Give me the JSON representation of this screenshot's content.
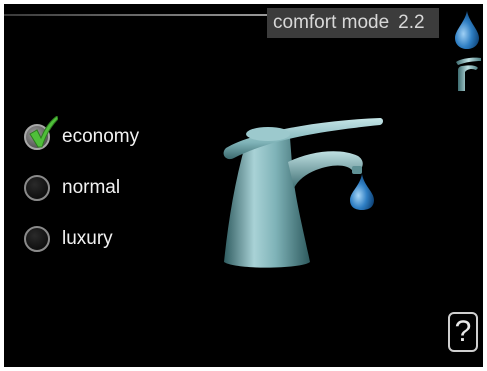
{
  "header": {
    "title": "comfort mode",
    "menu_number": "2.2"
  },
  "side_icons": [
    "water-drop-icon",
    "faucet-small-icon"
  ],
  "hero_icon": "faucet-with-drop-icon",
  "options": [
    {
      "label": "economy",
      "selected": true
    },
    {
      "label": "normal",
      "selected": false
    },
    {
      "label": "luxury",
      "selected": false
    }
  ],
  "help": {
    "label": "?"
  },
  "colors": {
    "background": "#000000",
    "title_bar": "#3c3c3c",
    "drop_blue": "#2f7fc4",
    "faucet_teal": "#7fb3b8",
    "check_green": "#4fbf3a"
  }
}
